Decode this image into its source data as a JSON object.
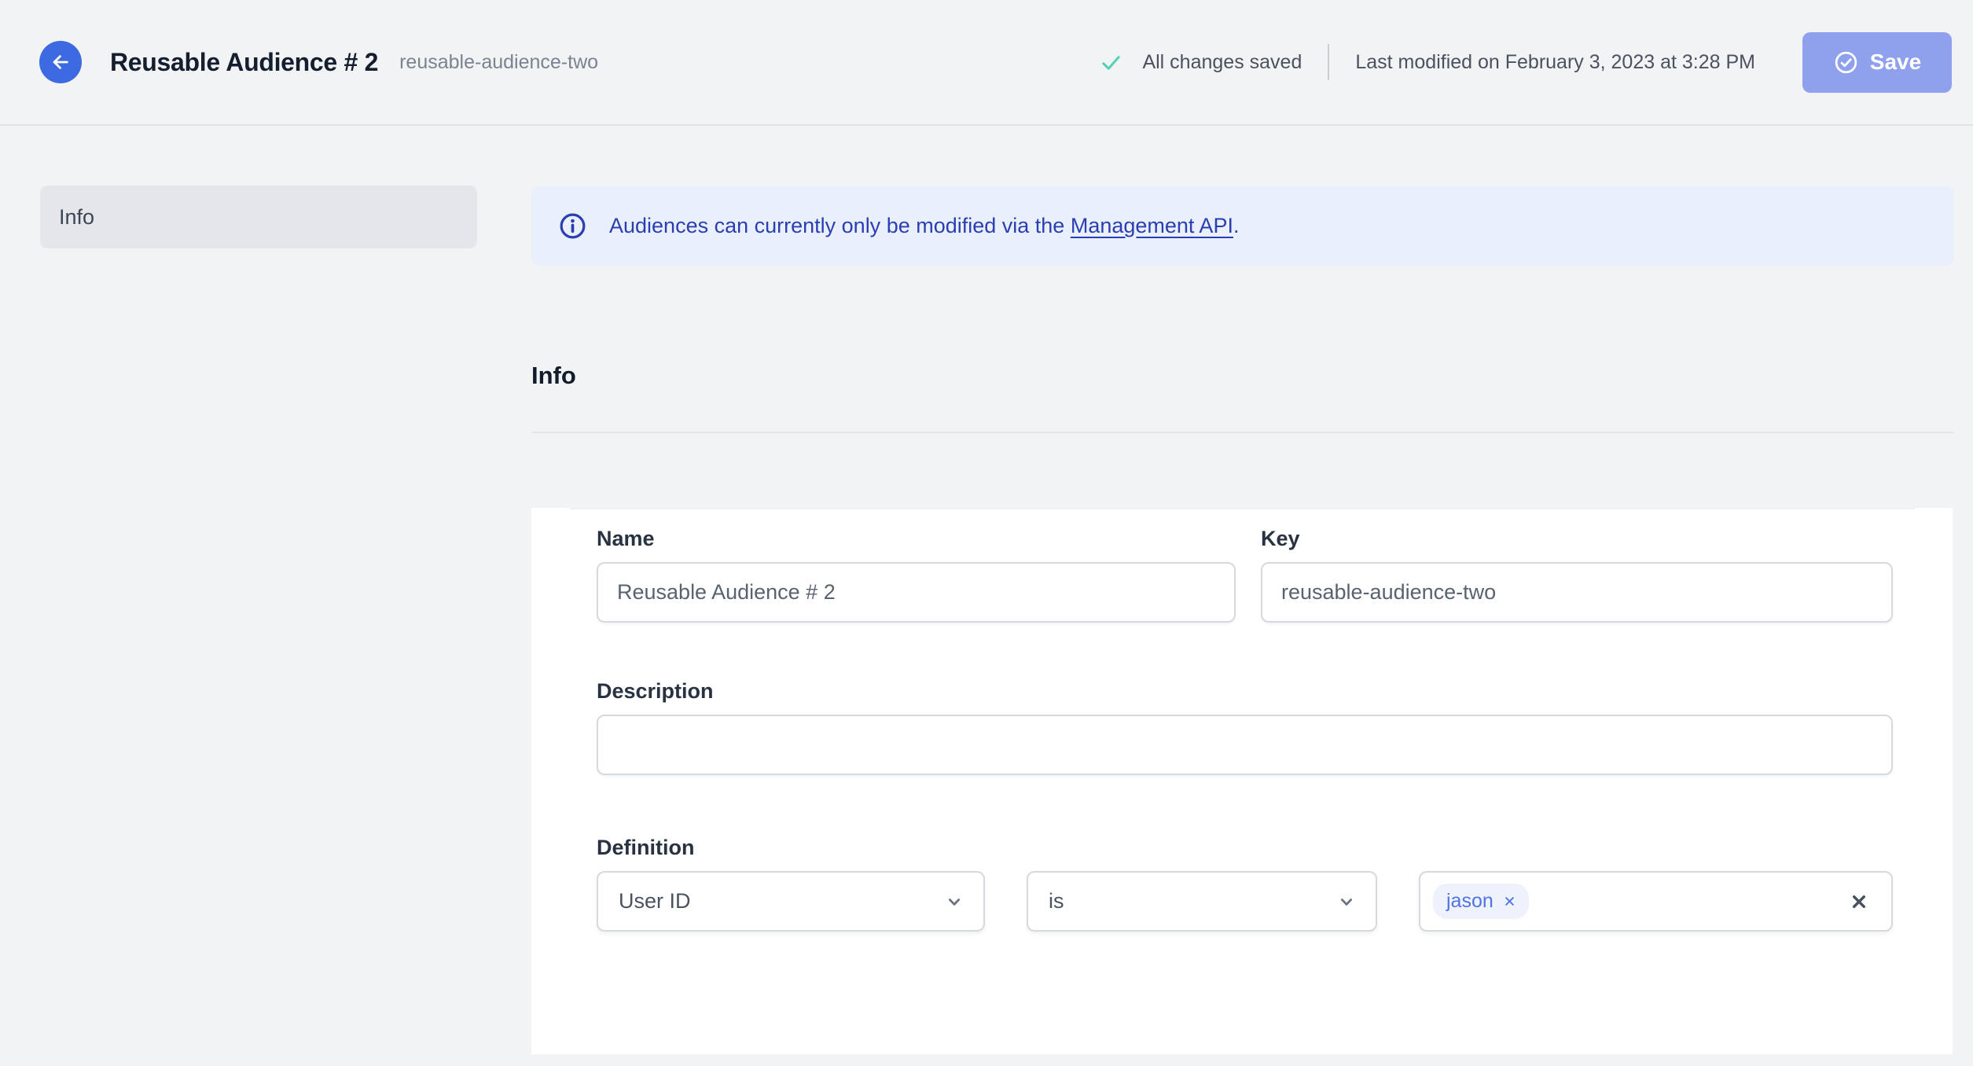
{
  "header": {
    "title": "Reusable Audience # 2",
    "subtitle": "reusable-audience-two",
    "status": "All changes saved",
    "last_modified": "Last modified on February 3, 2023 at 3:28 PM",
    "save_label": "Save"
  },
  "sidebar": {
    "items": [
      {
        "label": "Info",
        "active": true
      }
    ]
  },
  "banner": {
    "text_before_link": "Audiences can currently only be modified via the ",
    "link_text": "Management API",
    "text_after_link": "."
  },
  "section": {
    "title": "Info"
  },
  "form": {
    "name": {
      "label": "Name",
      "value": "Reusable Audience # 2"
    },
    "key": {
      "label": "Key",
      "value": "reusable-audience-two"
    },
    "description": {
      "label": "Description",
      "value": ""
    },
    "definition": {
      "label": "Definition",
      "trait_selected": "User ID",
      "operator_selected": "is",
      "values": [
        "jason"
      ]
    }
  },
  "colors": {
    "accent_blue": "#3E6AE1",
    "save_button": "#8FA0ED",
    "success_green": "#52D1B4",
    "banner_bg": "#E9F0FC",
    "banner_text": "#2B3EB1",
    "tag_bg": "#EDF2FD",
    "tag_text": "#5173E3",
    "page_bg": "#F2F3F5",
    "card_bg": "#FFFFFF"
  }
}
